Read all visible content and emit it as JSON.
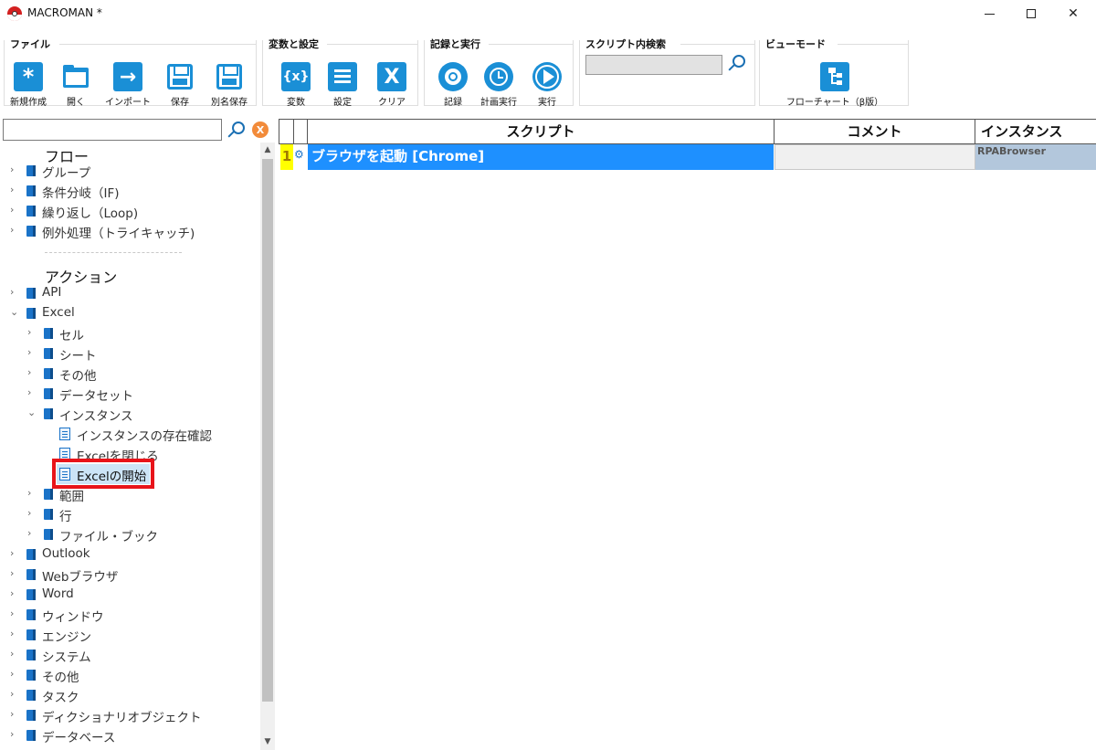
{
  "window": {
    "title": "MACROMAN *"
  },
  "toolbar": {
    "groups": [
      {
        "label": "ファイル",
        "buttons": [
          "新規作成",
          "開く",
          "インポート",
          "保存",
          "別名保存"
        ]
      },
      {
        "label": "変数と設定",
        "buttons": [
          "変数",
          "設定",
          "クリア"
        ]
      },
      {
        "label": "記録と実行",
        "buttons": [
          "記録",
          "計画実行",
          "実行"
        ]
      },
      {
        "label": "スクリプト内検索",
        "search_value": ""
      },
      {
        "label": "ビューモード",
        "buttons": [
          "フローチャート（β版）"
        ]
      }
    ],
    "icon_glyphs": {
      "new": "*",
      "var": "{x}",
      "clear": "X"
    }
  },
  "left_panel": {
    "search_value": "",
    "clear_glyph": "X",
    "flow_header": "フロー",
    "flow_items": [
      "グループ",
      "条件分岐（IF)",
      "繰り返し（Loop)",
      "例外処理（トライキャッチ)"
    ],
    "action_header": "アクション",
    "nodes": [
      {
        "label": "API",
        "expander": "›"
      },
      {
        "label": "Excel",
        "expander": "⌄"
      },
      {
        "label": "セル",
        "expander": "›"
      },
      {
        "label": "シート",
        "expander": "›"
      },
      {
        "label": "その他",
        "expander": "›"
      },
      {
        "label": "データセット",
        "expander": "›"
      },
      {
        "label": "インスタンス",
        "expander": "⌄"
      },
      {
        "label": "インスタンスの存在確認"
      },
      {
        "label": "Excelを閉じる"
      },
      {
        "label": "Excelの開始"
      },
      {
        "label": "範囲",
        "expander": "›"
      },
      {
        "label": "行",
        "expander": "›"
      },
      {
        "label": "ファイル・ブック",
        "expander": "›"
      },
      {
        "label": "Outlook",
        "expander": "›"
      },
      {
        "label": "Webブラウザ",
        "expander": "›"
      },
      {
        "label": "Word",
        "expander": "›"
      },
      {
        "label": "ウィンドウ",
        "expander": "›"
      },
      {
        "label": "エンジン",
        "expander": "›"
      },
      {
        "label": "システム",
        "expander": "›"
      },
      {
        "label": "その他",
        "expander": "›"
      },
      {
        "label": "タスク",
        "expander": "›"
      },
      {
        "label": "ディクショナリオブジェクト",
        "expander": "›"
      },
      {
        "label": "データベース",
        "expander": "›"
      }
    ]
  },
  "grid": {
    "columns": [
      "スクリプト",
      "コメント",
      "インスタンス"
    ],
    "rows": [
      {
        "num": "1",
        "script": "ブラウザを起動 [Chrome]",
        "comment": "",
        "instance": "RPABrowser"
      }
    ]
  },
  "colors": {
    "accent": "#1a8fd6",
    "selected_row": "#1e90ff",
    "highlight": "#e8141a"
  }
}
